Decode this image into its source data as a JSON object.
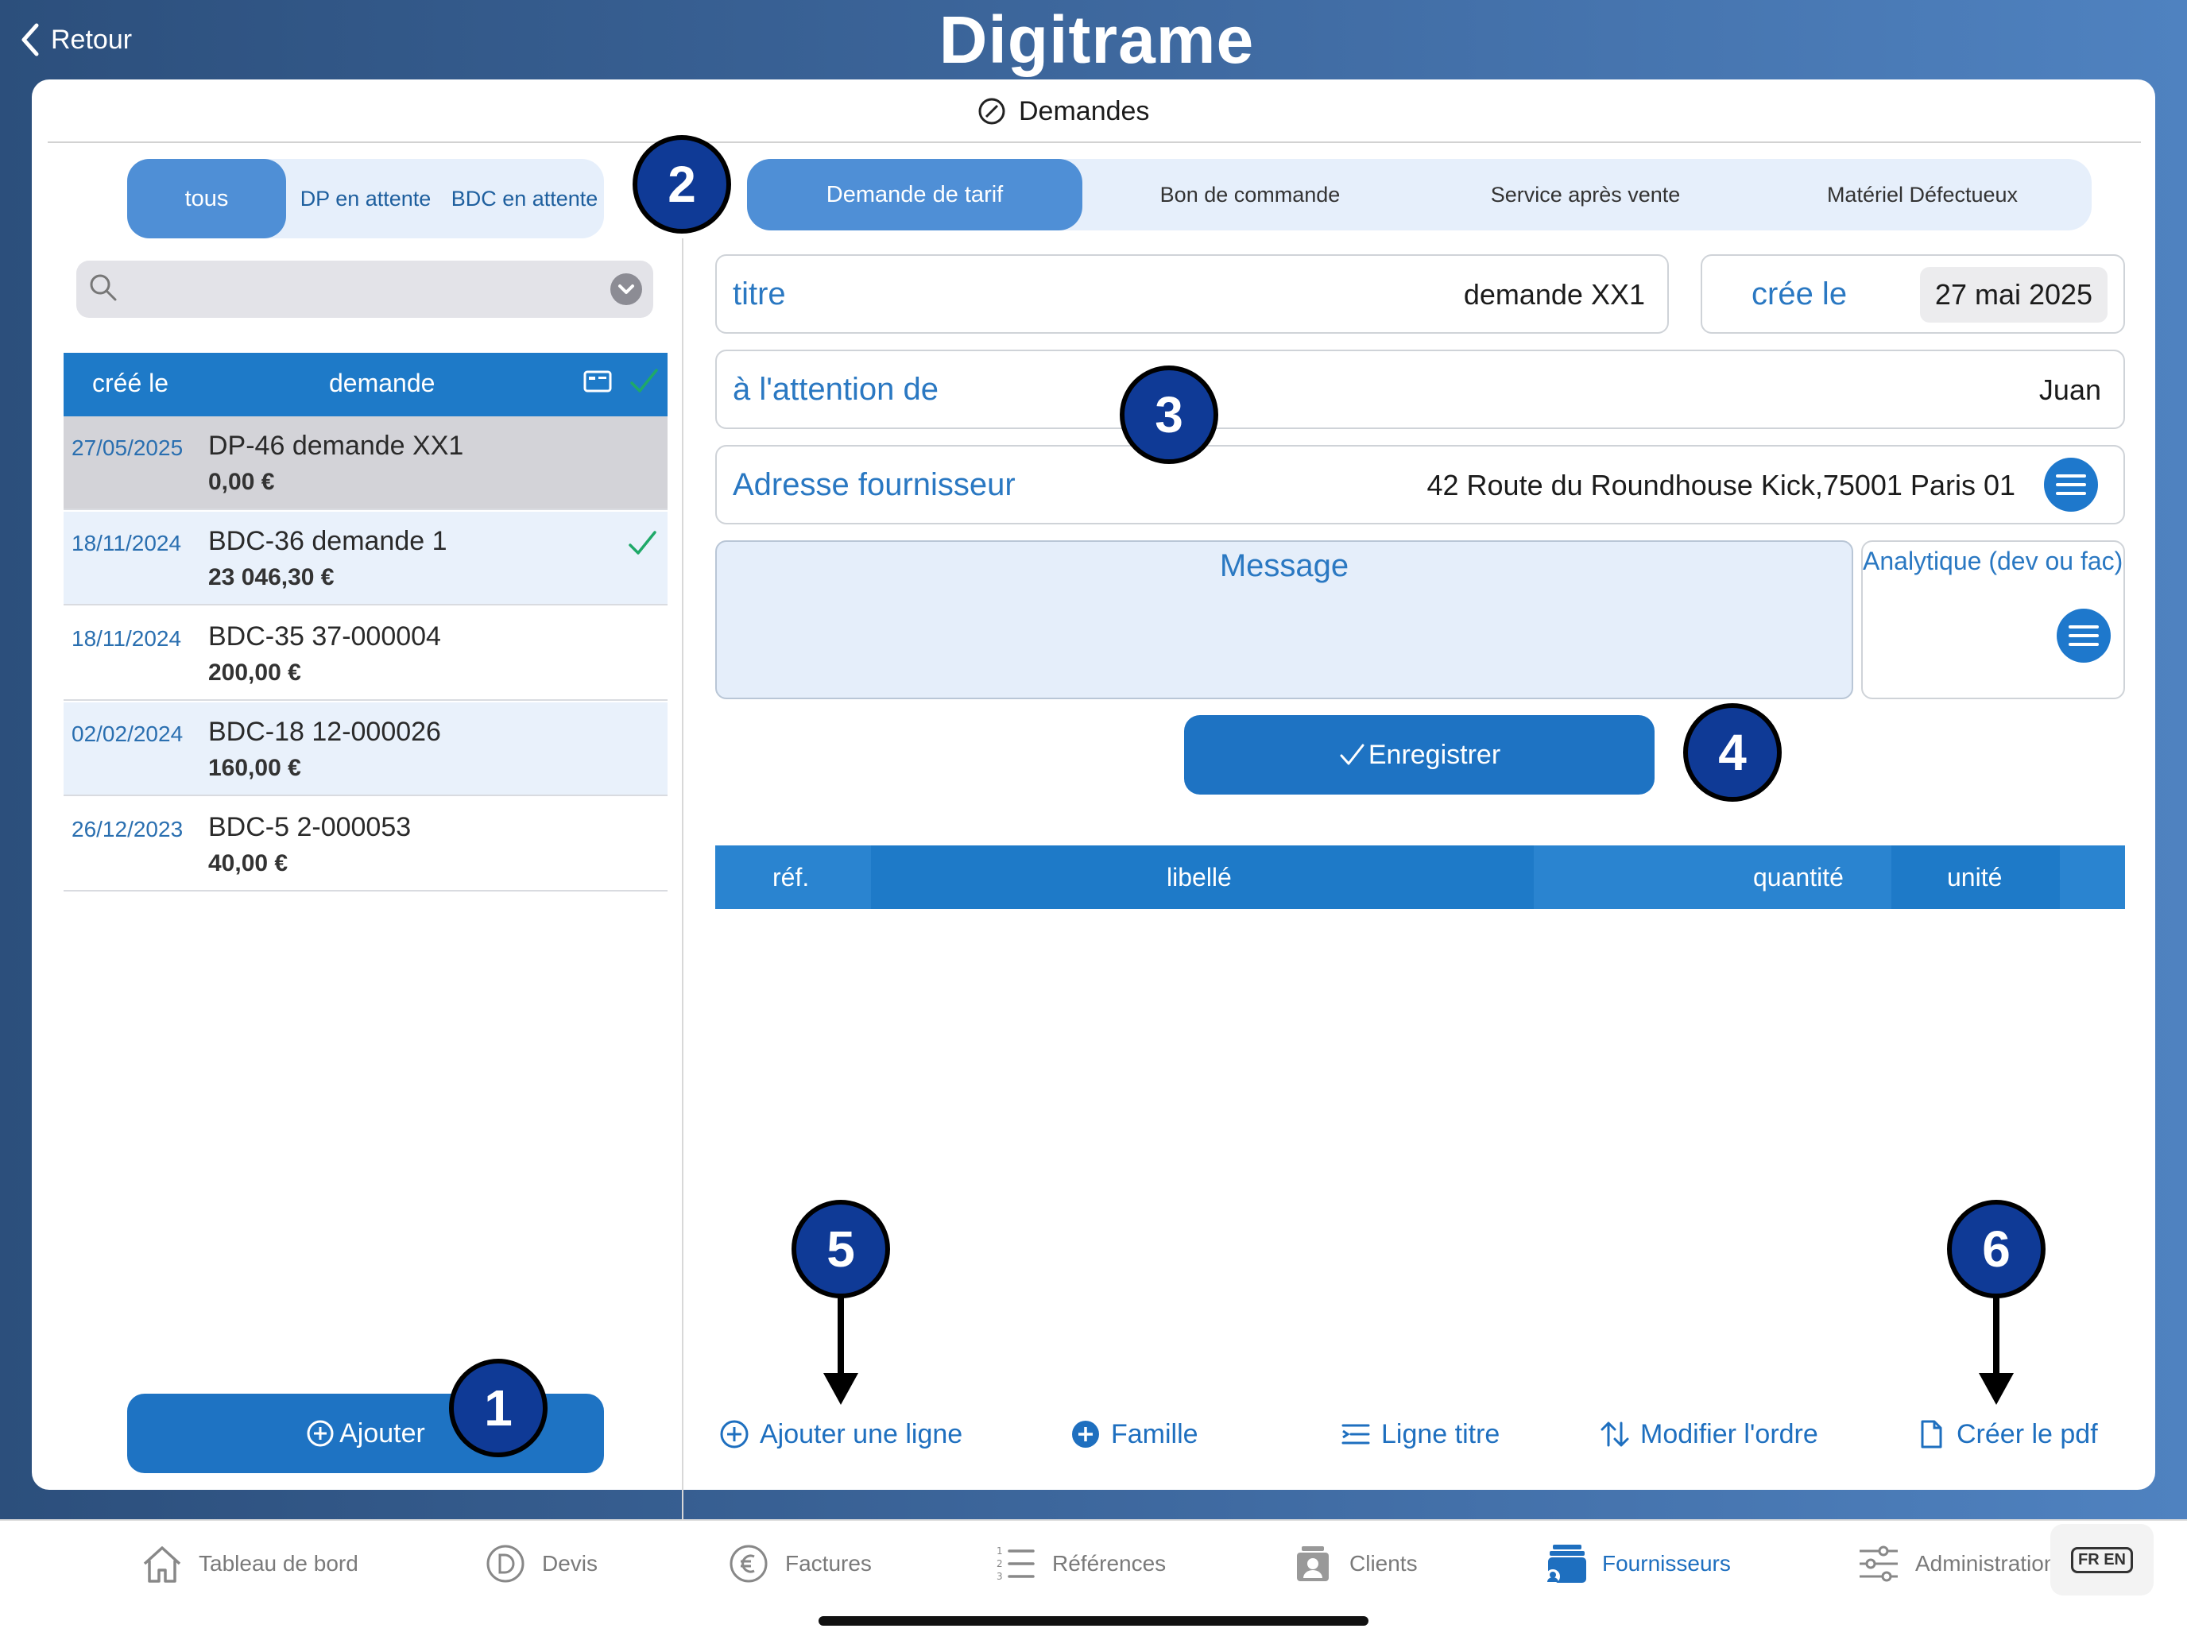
{
  "header": {
    "back_label": "Retour",
    "logo_text": "Digitrame"
  },
  "card": {
    "title": "Demandes"
  },
  "left_filter": {
    "options": [
      "tous",
      "DP en attente",
      "BDC en attente"
    ],
    "active": "tous"
  },
  "search": {
    "placeholder": ""
  },
  "list": {
    "headers": {
      "created": "créé le",
      "request": "demande"
    },
    "rows": [
      {
        "date": "27/05/2025",
        "title": "DP-46 demande XX1",
        "amount": "0,00 €",
        "checked": false
      },
      {
        "date": "18/11/2024",
        "title": "BDC-36 demande 1",
        "amount": "23 046,30 €",
        "checked": true
      },
      {
        "date": "18/11/2024",
        "title": "BDC-35 37-000004",
        "amount": "200,00 €",
        "checked": false
      },
      {
        "date": "02/02/2024",
        "title": "BDC-18 12-000026",
        "amount": "160,00 €",
        "checked": false
      },
      {
        "date": "26/12/2023",
        "title": "BDC-5 2-000053",
        "amount": "40,00 €",
        "checked": false
      }
    ]
  },
  "add_button": {
    "label": "Ajouter"
  },
  "tabs": {
    "items": [
      "Demande de tarif",
      "Bon de commande",
      "Service après vente",
      "Matériel Défectueux"
    ],
    "active": "Demande de tarif"
  },
  "form": {
    "title_label": "titre",
    "title_value": "demande XX1",
    "created_label": "crée le",
    "created_value": "27 mai 2025",
    "attention_label": "à l'attention de",
    "attention_value": "Juan",
    "address_label": "Adresse fournisseur",
    "address_value": "42 Route du Roundhouse Kick,75001 Paris 01",
    "message_label": "Message",
    "analytics_label": "Analytique (dev ou fac)"
  },
  "save_button": {
    "label": "Enregistrer"
  },
  "lines_table": {
    "headers": [
      "réf.",
      "libellé",
      "quantité",
      "unité"
    ]
  },
  "actions": [
    "Ajouter une ligne",
    "Famille",
    "Ligne titre",
    "Modifier l'ordre",
    "Créer le pdf"
  ],
  "badges": [
    "1",
    "2",
    "3",
    "4",
    "5",
    "6"
  ],
  "tabbar": {
    "items": [
      "Tableau de bord",
      "Devis",
      "Factures",
      "Références",
      "Clients",
      "Fournisseurs",
      "Administration"
    ],
    "active": "Fournisseurs",
    "lang_label": "FR EN"
  },
  "colors": {
    "primary": "#1e73c3",
    "accent_light": "#e6effb",
    "badge": "#0f3a96",
    "check": "#1fa968"
  }
}
